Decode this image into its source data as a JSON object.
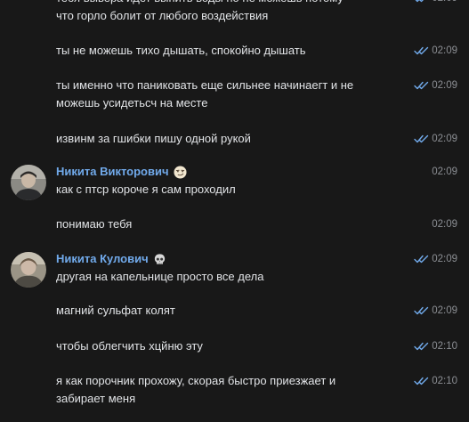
{
  "messages": [
    {
      "text": "тебя вывера идет выпить воды но не можешь потому\nчто горло болит от любого воздействия",
      "time": "02:09",
      "read": true
    },
    {
      "text": "ты не можешь тихо дышать, спокойно дышать",
      "time": "02:09",
      "read": true
    },
    {
      "text": "ты именно что паниковать еще сильнее начинаегт и не\nможешь усидетьсч на месте",
      "time": "02:09",
      "read": true
    },
    {
      "text": "извинм за гшибки пишу одной рукой",
      "time": "02:09",
      "read": true
    },
    {
      "author": "Никита Викторович",
      "author_emoji": "smirk-emoji",
      "text": "как с птср короче я сам проходил",
      "time": "02:09",
      "read": false
    },
    {
      "text": "понимаю тебя",
      "time": "02:09",
      "read": false
    },
    {
      "author": "Никита Кулович",
      "author_emoji": "skull-emoji",
      "text": "другая на капельнице просто все дела",
      "time": "02:09",
      "read": true
    },
    {
      "text": "магний сульфат колят",
      "time": "02:09",
      "read": true
    },
    {
      "text": "чтобы облегчить хцйню эту",
      "time": "02:10",
      "read": true
    },
    {
      "text": "я как порочник прохожу, скорая быстро приезжает и\nзабирает меня",
      "time": "02:10",
      "read": true
    }
  ],
  "colors": {
    "background": "#181818",
    "text": "#e1e3e6",
    "author": "#71aaeb",
    "time": "#8b8e93",
    "read_check": "#71aaeb"
  }
}
